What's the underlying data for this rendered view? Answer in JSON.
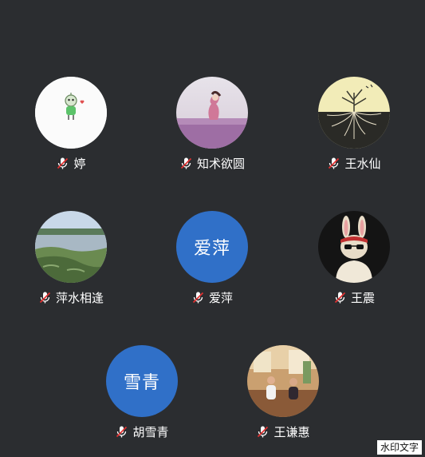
{
  "participants": [
    {
      "name": "婷",
      "avatar": "cartoon-character-photo",
      "muted": true
    },
    {
      "name": "知术欲圆",
      "avatar": "woman-in-lavender-field-photo",
      "muted": true
    },
    {
      "name": "王水仙",
      "avatar": "tree-roots-illustration",
      "muted": true
    },
    {
      "name": "萍水相逢",
      "avatar": "lake-landscape-photo",
      "muted": true
    },
    {
      "name": "爱萍",
      "avatar_text": "爱萍",
      "avatar_color": "#3070c8",
      "muted": true
    },
    {
      "name": "王震",
      "avatar": "cool-rabbit-photo",
      "muted": true
    },
    {
      "name": "胡雪青",
      "avatar_text": "雪青",
      "avatar_color": "#3070c8",
      "muted": true
    },
    {
      "name": "王谦惠",
      "avatar": "people-in-room-photo",
      "muted": true
    }
  ],
  "watermark": "水印文字",
  "colors": {
    "background": "#2b2d30",
    "text_avatar": "#3070c8",
    "mute_slash": "#e03030"
  }
}
